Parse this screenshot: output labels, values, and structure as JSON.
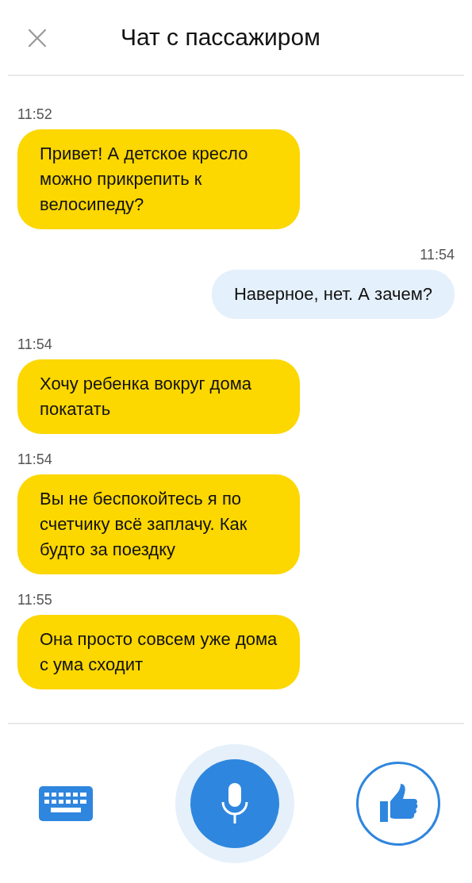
{
  "header": {
    "close": "×",
    "title": "Чат с пассажиром"
  },
  "messages": [
    {
      "time": "11:52",
      "kind": "incoming",
      "text": "Привет! А детское кресло можно прикрепить к велосипеду?"
    },
    {
      "time": "11:54",
      "kind": "outgoing",
      "text": "Наверное, нет. А зачем?"
    },
    {
      "time": "11:54",
      "kind": "incoming",
      "text": "Хочу ребенка вокруг дома покатать"
    },
    {
      "time": "11:54",
      "kind": "incoming",
      "text": "Вы не беспокойтесь я по счетчику всё заплачу. Как будто за поездку"
    },
    {
      "time": "11:55",
      "kind": "incoming",
      "text": "Она просто совсем уже дома с ума сходит"
    }
  ]
}
